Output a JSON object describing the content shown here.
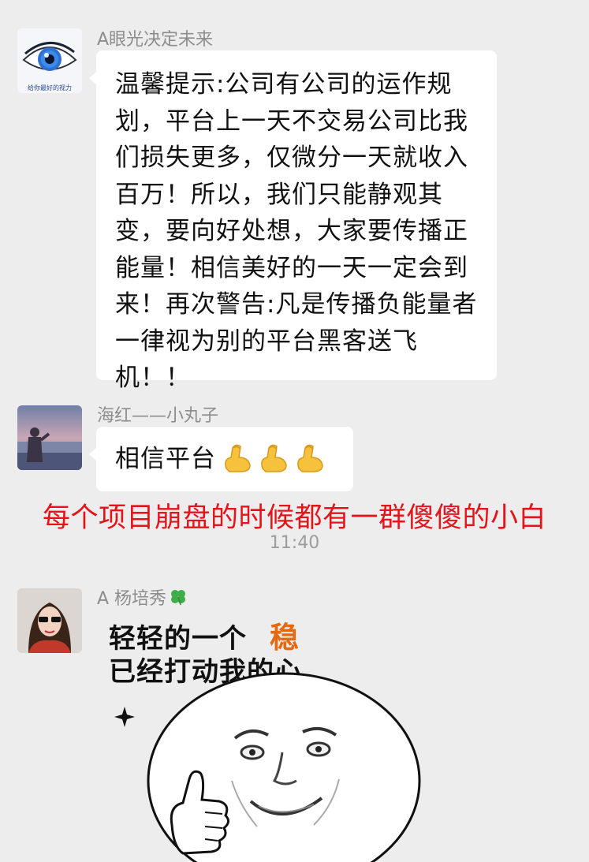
{
  "messages": [
    {
      "sender": "A眼光决定未来",
      "avatar_caption": "给你最好的视力",
      "text": "温馨提示:公司有公司的运作规划，平台上一天不交易公司比我们损失更多，仅微分一天就收入百万！所以，我们只能静观其变，要向好处想，大家要传播正能量！相信美好的一天一定会到来！再次警告:凡是传播负能量者一律视为别的平台黑客送飞机！！"
    },
    {
      "sender": "海红——小丸子",
      "text": "相信平台",
      "emoji": "flexed-biceps-icon"
    },
    {
      "sender": "A 杨培秀",
      "sender_icon": "clover-icon",
      "sticker": {
        "line1_prefix": "轻轻的一个",
        "line1_accent": "稳",
        "line2": "已经打动我的心"
      }
    }
  ],
  "annotation": "每个项目崩盘的时候都有一群傻傻的小白",
  "timestamp": "11:40",
  "colors": {
    "background": "#ededed",
    "bubble": "#ffffff",
    "sender": "#8d8d8d",
    "annotation": "#e5141b",
    "accent": "#e36a12"
  }
}
